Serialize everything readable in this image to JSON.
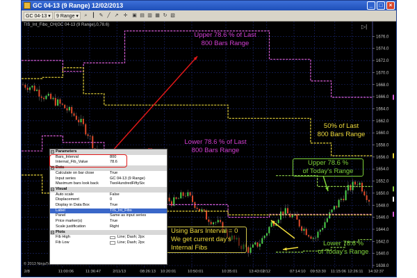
{
  "window": {
    "title": "GC 04-13 (9 Range)  12/02/2013",
    "controls": [
      "_",
      "□",
      "×"
    ]
  },
  "toolbar": {
    "instrument": "GC 04-13",
    "interval": "9 Range",
    "icons": [
      "zoom-icon",
      "bar-icon",
      "pencil-icon",
      "line-icon",
      "arrow-icon",
      "crosshair-icon",
      "window-icon",
      "properties-icon",
      "data-box-icon",
      "calendar-icon",
      "refresh-icon",
      "strategy-icon"
    ]
  },
  "chart_label": "TIS_Int_Fibo_CH(GC 04-13 (9 Range),0,78.6)",
  "copyright": "© 2013 NinjaTrader, LLC",
  "colors": {
    "background": "#000000",
    "upper_fib": "#d85cd8",
    "lower_fib": "#d85cd8",
    "fifty_pct": "#e6d33a",
    "intraday_fib": "#8ecf4a",
    "annotation_magenta": "#d43fd4",
    "annotation_yellow": "#f0dc3a",
    "annotation_green": "#7fd43a",
    "arrow": "#e01818"
  },
  "chart_data": {
    "type": "line",
    "ylim": [
      1638,
      1678
    ],
    "y_ticks": [
      1638.0,
      1640.0,
      1642.0,
      1644.0,
      1646.0,
      1648.0,
      1650.0,
      1652.0,
      1654.0,
      1656.0,
      1658.0,
      1660.0,
      1662.0,
      1664.0,
      1666.0,
      1668.0,
      1670.0,
      1672.0,
      1674.0,
      1676.0
    ],
    "x_ticks": [
      "2/8",
      "11:00:06",
      "11:36:47",
      "2/11/13",
      "08:26:13",
      "10:20:01",
      "10:50:01",
      "10:35:01",
      "13:43:02",
      "2/12",
      "07:14:10",
      "09:53:30",
      "11:15:06",
      "12:26:11",
      "14:32:37"
    ],
    "price_markers": [
      {
        "value": "1665.9",
        "color": "#d85cd8"
      },
      {
        "value": "1656.2",
        "color": "#e6d33a"
      },
      {
        "value": "1650.7",
        "color": "#8ecf4a"
      },
      {
        "value": "1649.0",
        "color": "#ffffff"
      },
      {
        "value": "1646.5",
        "color": "#d85cd8"
      }
    ],
    "series": [
      {
        "values": [
          1672.0,
          1672.0,
          1670.2,
          1671.6,
          1671.6,
          1676.9,
          1676.9,
          1676.9,
          1676.9,
          1676.9,
          1676.9,
          1676.9,
          1672.2,
          1672.2,
          1668.6,
          1665.9,
          1665.9
        ]
      },
      {
        "values": [
          1657.0,
          1659.5,
          1658.4,
          1658.4,
          1652.5,
          1652.5,
          1648.1,
          1648.1,
          1648.1,
          1648.1,
          1646.0,
          1646.0,
          1646.5,
          1646.5,
          1646.5,
          1646.5,
          1646.5
        ]
      },
      {
        "values": [
          1669.0,
          1669.2,
          1670.8,
          1666.5,
          1664.6,
          1664.6,
          1664.6,
          1664.6,
          1664.6,
          1664.6,
          1662.4,
          1662.4,
          1662.4,
          1662.4,
          1658.3,
          1656.2,
          1656.2
        ]
      },
      {
        "values": [
          1653.0,
          1650.0,
          1648.8,
          1648.6,
          1648.6,
          1648.6,
          1647.0,
          1647.0,
          1647.0,
          1647.0,
          1646.4,
          1646.4,
          1646.4,
          1646.4,
          1646.4,
          1646.4,
          1646.4
        ]
      },
      {
        "values": [
          1652.9,
          1652.9,
          1652.9,
          1651.1,
          1651.1,
          1651.1,
          1651.1
        ]
      },
      {
        "values": [
          1640.2,
          1640.2,
          1640.4,
          1640.5,
          1641.0,
          1641.9,
          1642.3
        ]
      },
      {
        "values": [
          1668.0,
          1667.5,
          1666.0,
          1665.2,
          1664.0,
          1662.5,
          1660.0,
          1656.0,
          1652.0,
          1650.0,
          1648.0,
          1649.5,
          1650.5,
          1649.0,
          1648.5,
          1650.0,
          1648.0,
          1646.0,
          1645.0,
          1643.0,
          1641.5,
          1640.5,
          1642.0,
          1645.0,
          1647.0,
          1646.0,
          1644.0,
          1642.5,
          1645.5,
          1648.0,
          1650.5,
          1652.0,
          1649.0
        ]
      }
    ]
  },
  "properties": {
    "sections": [
      {
        "name": "Parameters",
        "rows": [
          {
            "key": "Bars_Interval",
            "value": "800"
          },
          {
            "key": "Internal_Fib_Value",
            "value": "78.6"
          }
        ]
      },
      {
        "name": "Data",
        "rows": [
          {
            "key": "Calculate on bar close",
            "value": "True"
          },
          {
            "key": "Input series",
            "value": "GC 04-13 (9 Range)"
          },
          {
            "key": "Maximum bars look back",
            "value": "TwoHundredFiftySix"
          }
        ]
      },
      {
        "name": "Visual",
        "rows": [
          {
            "key": "Auto scale",
            "value": "False"
          },
          {
            "key": "Displacement",
            "value": "0"
          },
          {
            "key": "Display in Data Box",
            "value": "True"
          },
          {
            "key": "Label",
            "value": "TIS_Int_Fibs"
          },
          {
            "key": "Panel",
            "value": "Same as input series"
          },
          {
            "key": "Price marker(s)",
            "value": "True"
          },
          {
            "key": "Scale justification",
            "value": "Right"
          }
        ]
      },
      {
        "name": "Plots",
        "rows": [
          {
            "key": "Fib High",
            "value": "Line; Dash; 2px"
          },
          {
            "key": "Fib Low",
            "value": "Line; Dash; 2px"
          }
        ]
      }
    ]
  },
  "annotations": {
    "upper_last": [
      "Upper 78.6 % of Last",
      "800 Bars Range"
    ],
    "lower_last": [
      "Lower 78.6 % of Last",
      "800 Bars Range"
    ],
    "fifty_last": [
      "50% of Last",
      "800 Bars Range"
    ],
    "upper_today": [
      "Upper 78.6 %",
      "of Today's Range"
    ],
    "lower_today": [
      "Lower 78.6 %",
      "of Today's Range"
    ],
    "bars_interval_note": [
      "Using Bars Interval = 0",
      "We get current day's",
      "Internal Fibs"
    ]
  }
}
